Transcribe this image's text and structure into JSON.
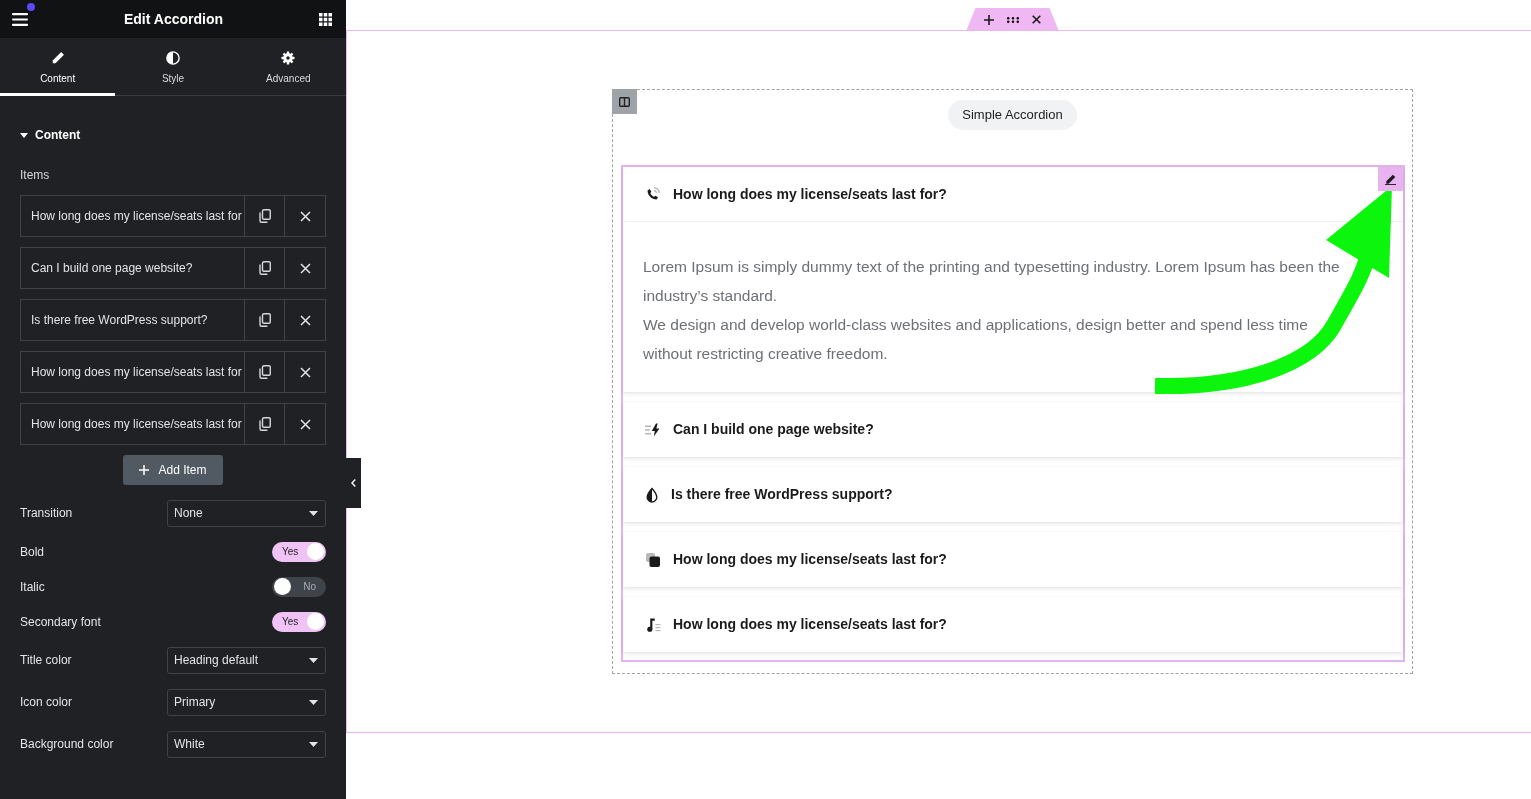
{
  "panel": {
    "title": "Edit Accordion",
    "has_notification": true,
    "tabs": [
      {
        "label": "Content",
        "selected": true
      },
      {
        "label": "Style",
        "selected": false
      },
      {
        "label": "Advanced",
        "selected": false
      }
    ],
    "section": {
      "title": "Content",
      "expanded": true
    },
    "items_label": "Items",
    "items": [
      {
        "title": "How long does my license/seats last for"
      },
      {
        "title": "Can I build one page website?"
      },
      {
        "title": "Is there free WordPress support?"
      },
      {
        "title": "How long does my license/seats last for"
      },
      {
        "title": "How long does my license/seats last for"
      }
    ],
    "add_button": "Add Item",
    "controls": [
      {
        "kind": "select",
        "label": "Transition",
        "value": "None"
      },
      {
        "kind": "toggle",
        "label": "Bold",
        "on": true,
        "text": "Yes"
      },
      {
        "kind": "toggle",
        "label": "Italic",
        "on": false,
        "text": "No"
      },
      {
        "kind": "toggle",
        "label": "Secondary font",
        "on": true,
        "text": "Yes"
      },
      {
        "kind": "select",
        "label": "Title color",
        "value": "Heading default"
      },
      {
        "kind": "select",
        "label": "Icon color",
        "value": "Primary"
      },
      {
        "kind": "select",
        "label": "Background color",
        "value": "White"
      }
    ]
  },
  "canvas": {
    "widget_label": "Simple Accordion",
    "accordion": {
      "items": [
        {
          "title": "How long does my license/seats last for?",
          "expanded": true,
          "body": [
            "Lorem Ipsum is simply dummy text of the printing and typesetting industry. Lorem Ipsum has been the industry’s standard.",
            "We design and develop world-class websites and applications, design better and spend less time without restricting creative freedom."
          ]
        },
        {
          "title": "Can I build one page website?",
          "expanded": false
        },
        {
          "title": "Is there free WordPress support?",
          "expanded": false
        },
        {
          "title": "How long does my license/seats last for?",
          "expanded": false
        },
        {
          "title": "How long does my license/seats last for?",
          "expanded": false
        }
      ]
    }
  }
}
